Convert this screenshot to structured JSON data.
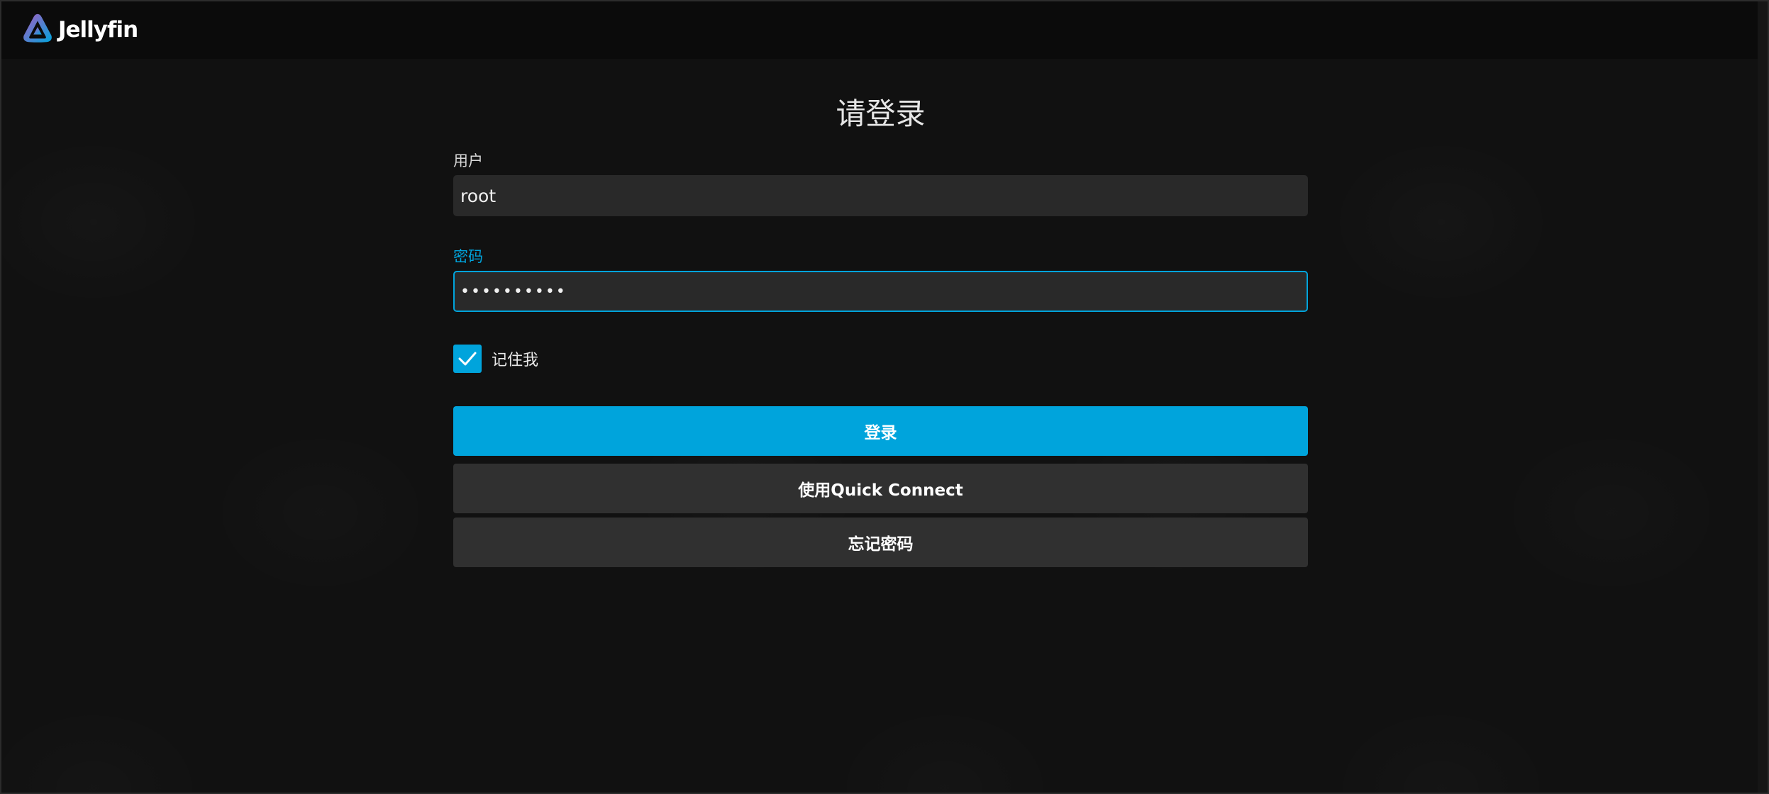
{
  "header": {
    "brand": "Jellyfin"
  },
  "login": {
    "title": "请登录",
    "username_label": "用户",
    "username_value": "root",
    "password_label": "密码",
    "password_value": "••••••••••",
    "remember_label": "记住我",
    "remember_checked": true,
    "sign_in_button": "登录",
    "quick_connect_button": "使用Quick Connect",
    "forgot_password_button": "忘记密码"
  },
  "colors": {
    "accent": "#00a4dc",
    "background": "#111111",
    "header": "#0b0b0b",
    "input": "#292929",
    "secondary_button": "#303030",
    "logo_gradient_start": "#aa5cc3",
    "logo_gradient_end": "#00a4dc"
  }
}
